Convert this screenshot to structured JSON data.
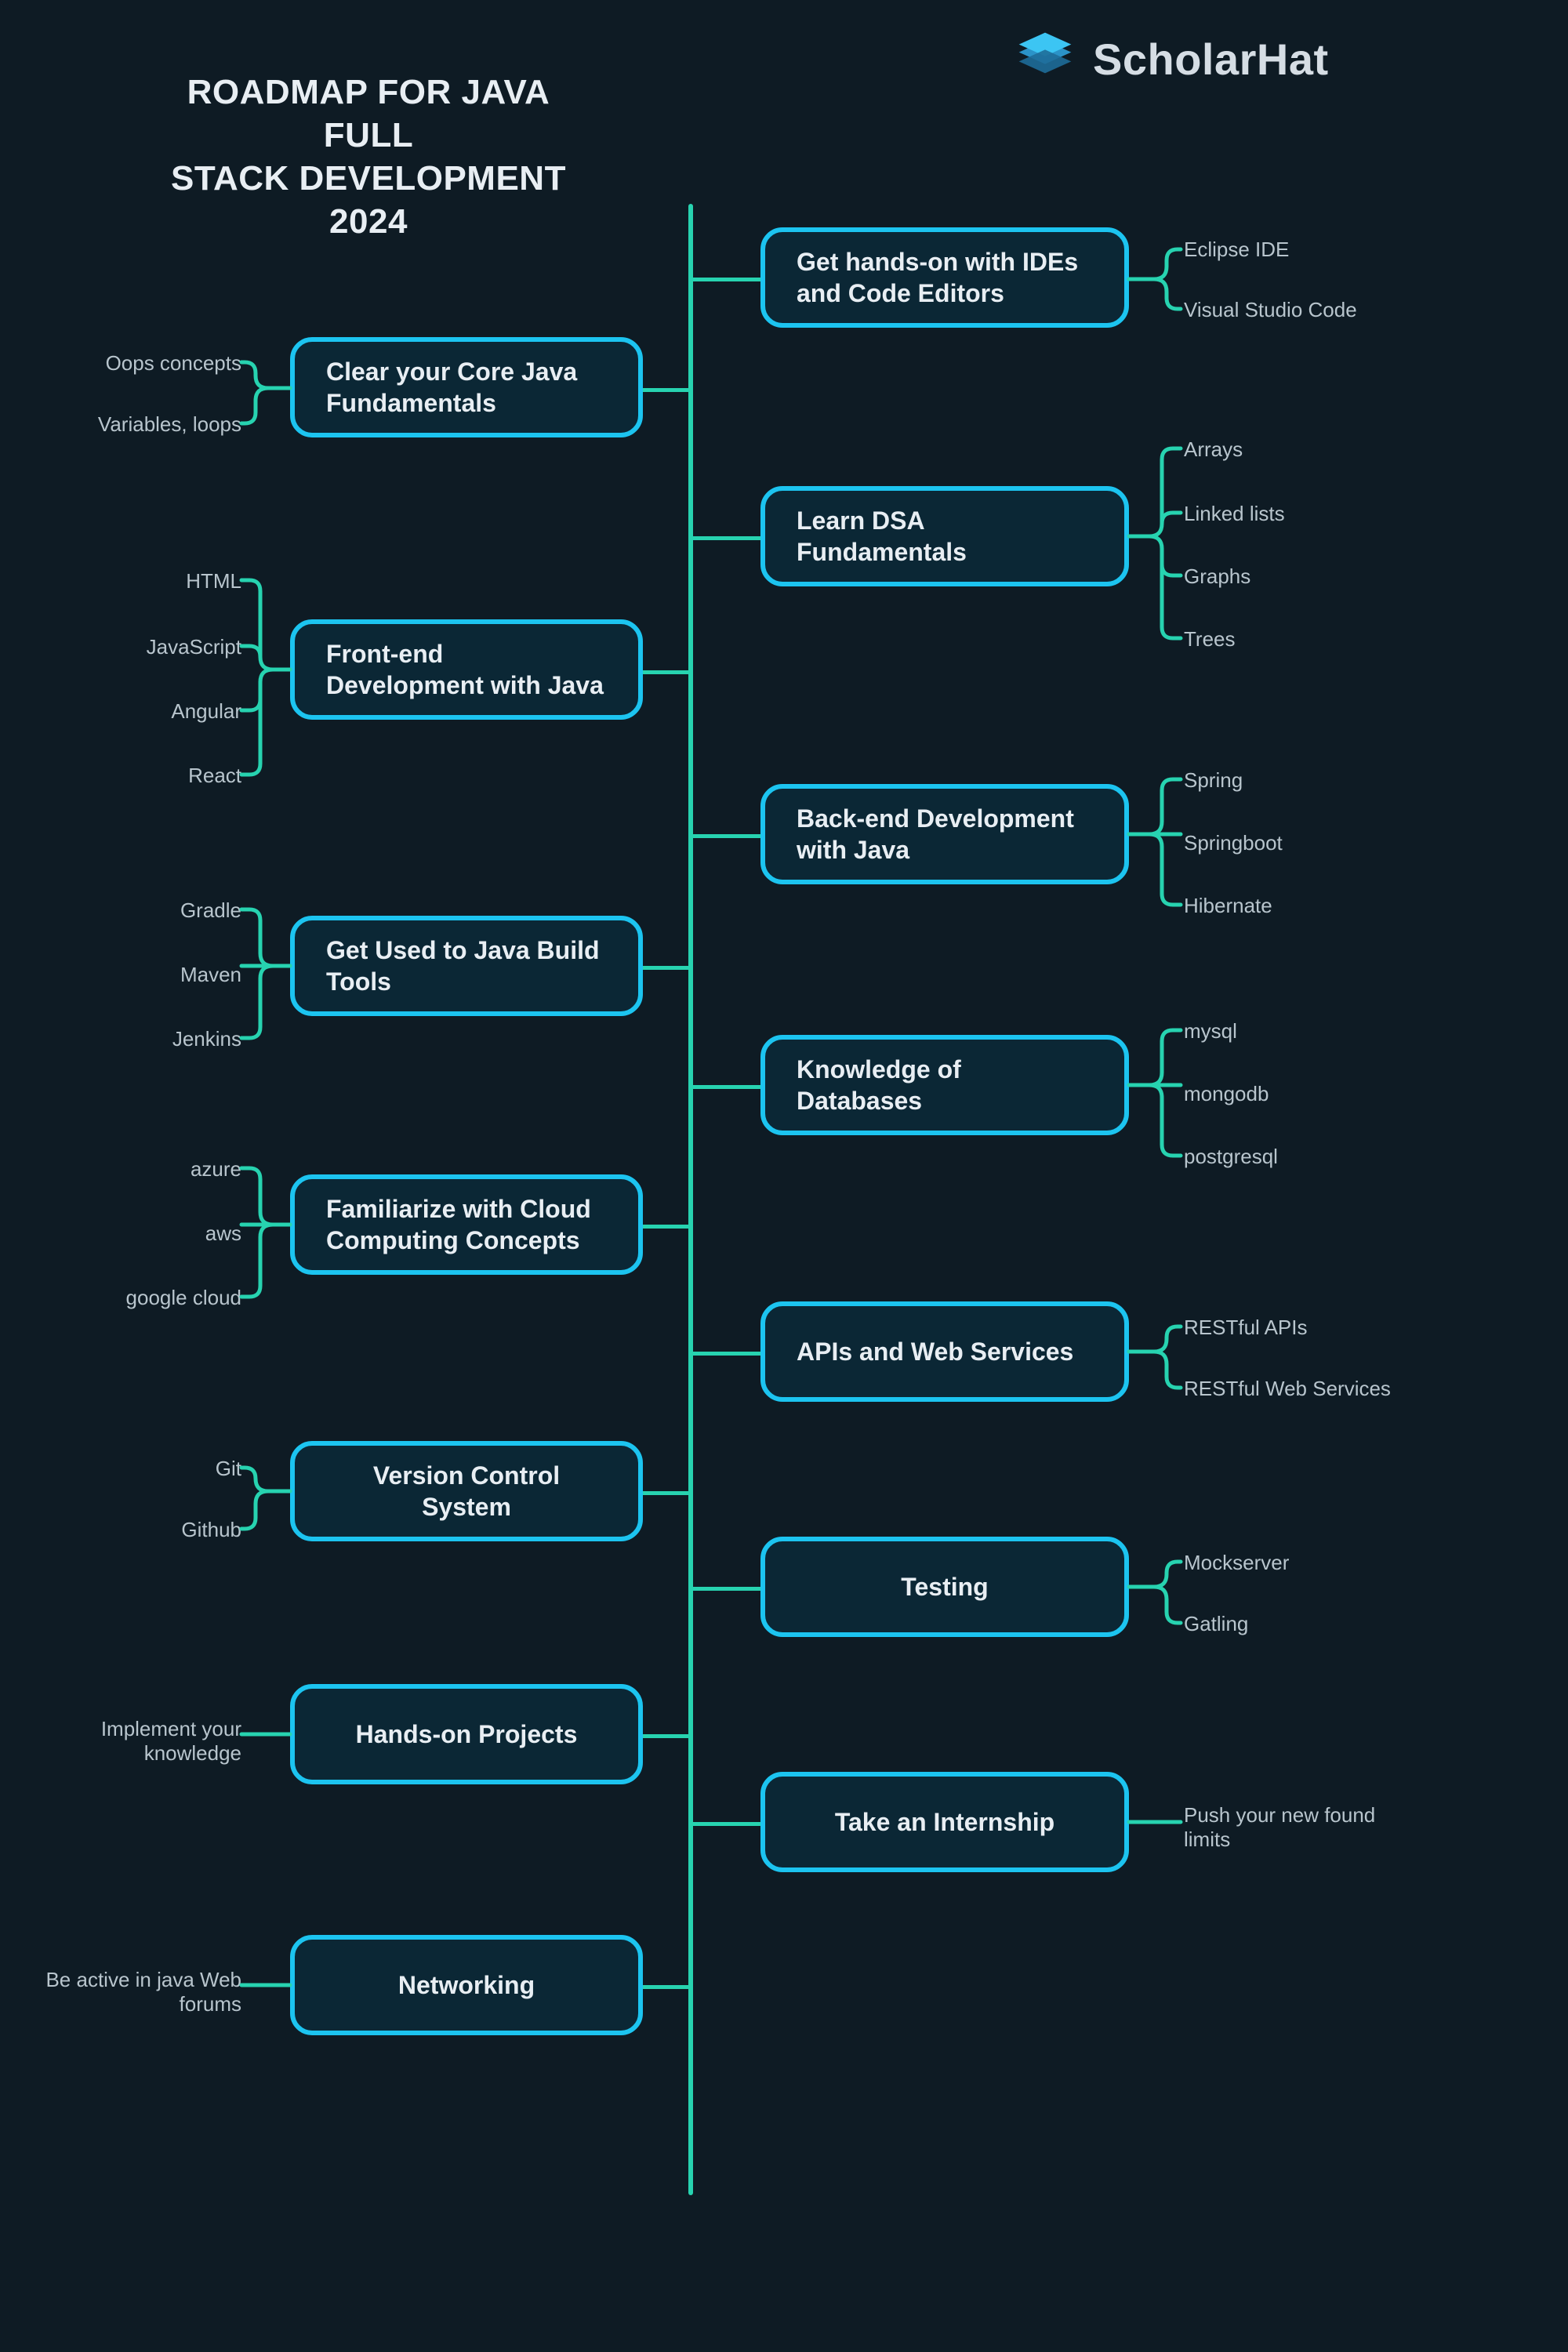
{
  "brand": "ScholarHat",
  "title_line1": "ROADMAP FOR JAVA FULL",
  "title_line2": "STACK DEVELOPMENT",
  "title_line3": "2024",
  "nodes": {
    "ides": {
      "label": "Get hands-on with IDEs and Code Editors",
      "leaves": [
        "Eclipse IDE",
        "Visual Studio Code"
      ]
    },
    "core": {
      "label": "Clear your Core Java Fundamentals",
      "leaves": [
        "Oops concepts",
        "Variables, loops"
      ]
    },
    "dsa": {
      "label": "Learn DSA Fundamentals",
      "leaves": [
        "Arrays",
        "Linked lists",
        "Graphs",
        "Trees"
      ]
    },
    "frontend": {
      "label": "Front-end Development with Java",
      "leaves": [
        "HTML",
        "JavaScript",
        "Angular",
        "React"
      ]
    },
    "backend": {
      "label": "Back-end Development with Java",
      "leaves": [
        "Spring",
        "Springboot",
        "Hibernate"
      ]
    },
    "build": {
      "label": "Get Used to Java Build Tools",
      "leaves": [
        "Gradle",
        "Maven",
        "Jenkins"
      ]
    },
    "db": {
      "label": "Knowledge of Databases",
      "leaves": [
        "mysql",
        "mongodb",
        "postgresql"
      ]
    },
    "cloud": {
      "label": "Familiarize with Cloud Computing Concepts",
      "leaves": [
        "azure",
        "aws",
        "google cloud"
      ]
    },
    "apis": {
      "label": "APIs and Web Services",
      "leaves": [
        "RESTful APIs",
        "RESTful Web Services"
      ]
    },
    "vcs": {
      "label": "Version Control System",
      "leaves": [
        "Git",
        "Github"
      ]
    },
    "testing": {
      "label": "Testing",
      "leaves": [
        "Mockserver",
        "Gatling"
      ]
    },
    "projects": {
      "label": "Hands-on Projects",
      "leaves": [
        "Implement your knowledge"
      ]
    },
    "intern": {
      "label": "Take an Internship",
      "leaves": [
        "Push your new found limits"
      ]
    },
    "networking": {
      "label": "Networking",
      "leaves": [
        "Be active in java Web forums"
      ]
    }
  }
}
